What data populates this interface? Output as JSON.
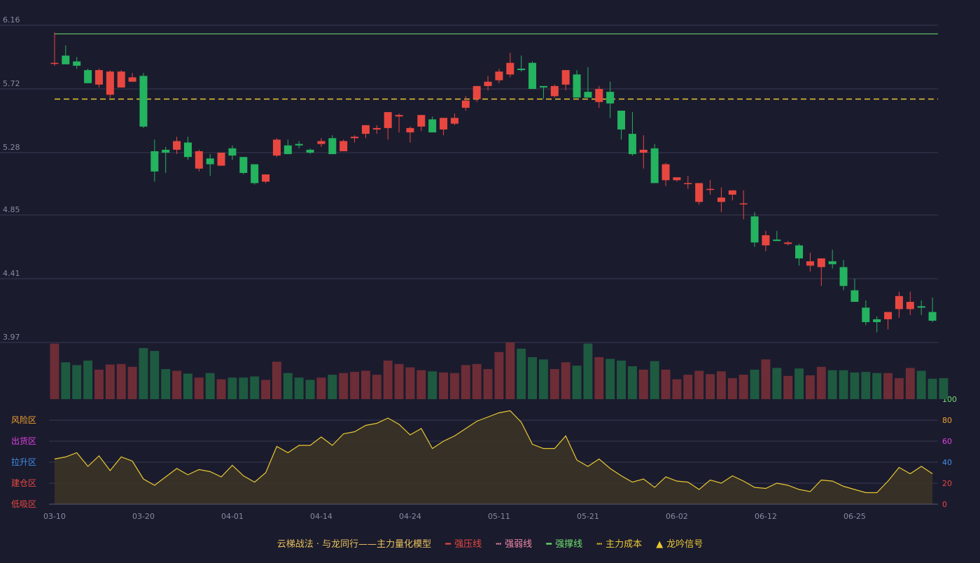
{
  "chart_data": {
    "type": "candlestick",
    "x_ticks": [
      "03-10",
      "03-20",
      "04-01",
      "04-14",
      "04-24",
      "05-11",
      "05-21",
      "06-02",
      "06-12",
      "06-25"
    ],
    "price_axis": {
      "ticks": [
        "6.16",
        "5.72",
        "5.28",
        "4.85",
        "4.41",
        "3.97"
      ],
      "range": [
        3.97,
        6.16
      ]
    },
    "strong_support_level": 6.1,
    "main_cost_level": 5.65,
    "ohlc": [
      [
        5.9,
        6.11,
        5.88,
        5.9
      ],
      [
        5.95,
        6.02,
        5.9,
        5.89
      ],
      [
        5.91,
        5.94,
        5.86,
        5.88
      ],
      [
        5.85,
        5.86,
        5.78,
        5.76
      ],
      [
        5.75,
        5.86,
        5.73,
        5.85
      ],
      [
        5.68,
        5.85,
        5.66,
        5.84
      ],
      [
        5.73,
        5.85,
        5.73,
        5.84
      ],
      [
        5.77,
        5.83,
        5.77,
        5.8
      ],
      [
        5.81,
        5.83,
        5.45,
        5.46
      ],
      [
        5.29,
        5.37,
        5.08,
        5.15
      ],
      [
        5.3,
        5.32,
        5.14,
        5.28
      ],
      [
        5.3,
        5.39,
        5.27,
        5.36
      ],
      [
        5.35,
        5.39,
        5.23,
        5.25
      ],
      [
        5.17,
        5.3,
        5.15,
        5.29
      ],
      [
        5.24,
        5.27,
        5.12,
        5.2
      ],
      [
        5.19,
        5.28,
        5.19,
        5.28
      ],
      [
        5.31,
        5.33,
        5.23,
        5.26
      ],
      [
        5.25,
        5.25,
        5.13,
        5.14
      ],
      [
        5.2,
        5.2,
        5.06,
        5.07
      ],
      [
        5.08,
        5.13,
        5.07,
        5.13
      ],
      [
        5.26,
        5.38,
        5.25,
        5.37
      ],
      [
        5.33,
        5.37,
        5.27,
        5.27
      ],
      [
        5.34,
        5.36,
        5.31,
        5.33
      ],
      [
        5.3,
        5.31,
        5.27,
        5.28
      ],
      [
        5.34,
        5.38,
        5.32,
        5.36
      ],
      [
        5.38,
        5.4,
        5.27,
        5.27
      ],
      [
        5.29,
        5.37,
        5.29,
        5.36
      ],
      [
        5.38,
        5.4,
        5.35,
        5.39
      ],
      [
        5.41,
        5.45,
        5.38,
        5.47
      ],
      [
        5.44,
        5.47,
        5.41,
        5.45
      ],
      [
        5.45,
        5.56,
        5.37,
        5.56
      ],
      [
        5.53,
        5.55,
        5.42,
        5.54
      ],
      [
        5.42,
        5.46,
        5.35,
        5.45
      ],
      [
        5.46,
        5.54,
        5.43,
        5.54
      ],
      [
        5.51,
        5.53,
        5.42,
        5.42
      ],
      [
        5.44,
        5.52,
        5.4,
        5.52
      ],
      [
        5.48,
        5.55,
        5.47,
        5.52
      ],
      [
        5.59,
        5.67,
        5.57,
        5.64
      ],
      [
        5.65,
        5.74,
        5.63,
        5.74
      ],
      [
        5.74,
        5.81,
        5.71,
        5.77
      ],
      [
        5.78,
        5.86,
        5.76,
        5.84
      ],
      [
        5.82,
        5.97,
        5.8,
        5.9
      ],
      [
        5.86,
        5.95,
        5.84,
        5.85
      ],
      [
        5.9,
        5.91,
        5.74,
        5.72
      ],
      [
        5.74,
        5.74,
        5.65,
        5.73
      ],
      [
        5.67,
        5.75,
        5.66,
        5.74
      ],
      [
        5.75,
        5.85,
        5.71,
        5.85
      ],
      [
        5.82,
        5.85,
        5.66,
        5.66
      ],
      [
        5.7,
        5.87,
        5.66,
        5.66
      ],
      [
        5.63,
        5.74,
        5.59,
        5.72
      ],
      [
        5.7,
        5.77,
        5.52,
        5.62
      ],
      [
        5.57,
        5.57,
        5.37,
        5.44
      ],
      [
        5.41,
        5.56,
        5.26,
        5.27
      ],
      [
        5.28,
        5.4,
        5.17,
        5.3
      ],
      [
        5.31,
        5.34,
        5.07,
        5.07
      ],
      [
        5.09,
        5.21,
        5.05,
        5.2
      ],
      [
        5.09,
        5.09,
        5.08,
        5.11
      ],
      [
        5.07,
        5.12,
        5.03,
        5.07
      ],
      [
        4.94,
        5.07,
        4.92,
        5.07
      ],
      [
        5.03,
        5.09,
        4.99,
        5.03
      ],
      [
        4.94,
        5.04,
        4.87,
        4.97
      ],
      [
        4.99,
        5.01,
        4.95,
        5.02
      ],
      [
        4.93,
        5.02,
        4.82,
        4.93
      ],
      [
        4.84,
        4.87,
        4.63,
        4.66
      ],
      [
        4.64,
        4.74,
        4.6,
        4.71
      ],
      [
        4.68,
        4.74,
        4.67,
        4.67
      ],
      [
        4.65,
        4.67,
        4.64,
        4.66
      ],
      [
        4.64,
        4.65,
        4.5,
        4.55
      ],
      [
        4.5,
        4.59,
        4.46,
        4.53
      ],
      [
        4.49,
        4.51,
        4.36,
        4.55
      ],
      [
        4.53,
        4.61,
        4.48,
        4.51
      ],
      [
        4.49,
        4.54,
        4.33,
        4.36
      ],
      [
        4.33,
        4.41,
        4.28,
        4.25
      ],
      [
        4.21,
        4.26,
        4.09,
        4.11
      ],
      [
        4.13,
        4.15,
        4.04,
        4.11
      ],
      [
        4.13,
        4.18,
        4.06,
        4.18
      ],
      [
        4.2,
        4.32,
        4.14,
        4.29
      ],
      [
        4.2,
        4.32,
        4.16,
        4.25
      ],
      [
        4.22,
        4.26,
        4.16,
        4.21
      ],
      [
        4.18,
        4.28,
        4.11,
        4.12
      ]
    ],
    "volume": [
      98,
      65,
      60,
      68,
      52,
      61,
      62,
      57,
      90,
      85,
      53,
      50,
      45,
      38,
      46,
      35,
      38,
      38,
      40,
      34,
      66,
      46,
      38,
      34,
      38,
      43,
      46,
      48,
      50,
      43,
      68,
      62,
      56,
      51,
      49,
      47,
      46,
      60,
      62,
      53,
      83,
      100,
      89,
      74,
      70,
      53,
      65,
      59,
      98,
      74,
      71,
      68,
      58,
      52,
      67,
      52,
      35,
      43,
      50,
      44,
      49,
      37,
      43,
      52,
      70,
      55,
      41,
      54,
      42,
      57,
      51,
      51,
      47,
      48,
      46,
      46,
      37,
      55,
      50,
      36,
      37
    ],
    "rhythm_line": [
      43,
      45,
      49,
      36,
      46,
      32,
      45,
      41,
      24,
      18,
      26,
      34,
      28,
      33,
      31,
      26,
      37,
      27,
      21,
      30,
      55,
      49,
      56,
      56,
      64,
      56,
      67,
      69,
      75,
      77,
      82,
      76,
      66,
      72,
      53,
      60,
      65,
      72,
      79,
      83,
      87,
      89,
      78,
      57,
      53,
      53,
      65,
      42,
      36,
      43,
      34,
      27,
      21,
      24,
      16,
      26,
      22,
      21,
      14,
      23,
      20,
      27,
      22,
      16,
      15,
      20,
      18,
      14,
      12,
      23,
      22,
      17,
      14,
      11,
      11,
      22,
      35,
      29,
      36,
      29
    ],
    "risk_zones": [
      "风险区",
      "出货区",
      "拉升区",
      "建仓区",
      "低吸区"
    ],
    "osc_axis": {
      "ticks": [
        "100",
        "80",
        "60",
        "40",
        "20",
        "0"
      ],
      "range": [
        0,
        100
      ]
    }
  },
  "legend": {
    "model": "云梯战法 · 与龙同行——主力量化模型",
    "strong_pressure": "强压线",
    "weak_line": "强弱线",
    "strong_support": "强撑线",
    "main_cost": "主力成本",
    "signal": "龙吟信号"
  },
  "colors": {
    "background": "#1b1b2e",
    "up": "#e8473f",
    "down": "#24b35f",
    "up_volume": "#6d2d36",
    "down_volume": "#1e5a40",
    "support_line": "#6ee06e",
    "cost_line": "#e8c832",
    "rhythm": "#e8c832",
    "zone_risk": "#f0a030",
    "zone_ship": "#e040e0",
    "zone_pull": "#3d8fe6",
    "zone_build": "#e8473f",
    "zone_low": "#e8473f"
  }
}
